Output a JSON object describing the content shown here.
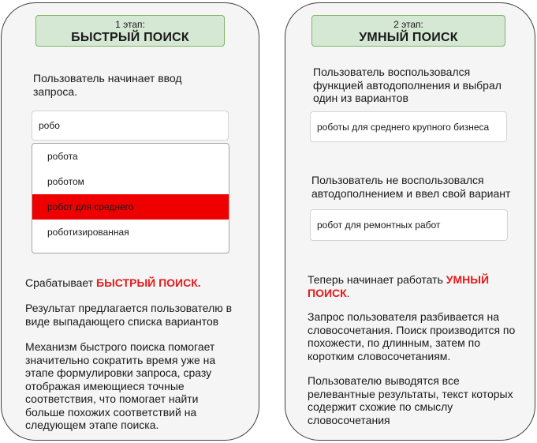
{
  "stage1": {
    "stage_label": "1 этап:",
    "title": "БЫСТРЫЙ ПОИСК",
    "intro": "Пользователь начинает ввод запроса.",
    "query_value": "робо",
    "suggestions": [
      "робота",
      "роботом",
      "робот для среднего",
      "роботизированная"
    ],
    "selected_index": 2,
    "triggers_prefix": "Срабатывает ",
    "triggers_highlight": "БЫСТРЫЙ ПОИСК.",
    "result_text": "Результат предлагается пользователю в виде выпадающего списка вариантов",
    "mechanism_text": "Механизм быстрого поиска помогает значительно сократить время уже на этапе формулировки запроса, сразу отображая имеющиеся точные соответствия, что помогает найти больше похожих соответствий на следующем этапе поиска."
  },
  "stage2": {
    "stage_label": "2 этап:",
    "title": "УМНЫЙ ПОИСК",
    "autocomplete_text": "Пользователь воспользовался функцией автодополнения и выбрал один из вариантов",
    "autocomplete_value": "роботы для среднего крупного бизнеса",
    "manual_text": "Пользователь не воспользовался автодополнением и ввел свой вариант",
    "manual_value": "робот для ремонтных работ",
    "now_prefix": "Теперь начинает работать ",
    "now_highlight": "УМНЫЙ ПОИСК",
    "now_suffix": ".",
    "split_text": "Запрос пользователя разбивается на словосочетания. Поиск производится по похожести, по длинным, затем по коротким словосочетаниям.",
    "results_text": "Пользователю выводятся все релевантные результаты, текст которых содержит схожие по смыслу словосочетания"
  },
  "colors": {
    "badge_fill": "#d5e8d4",
    "badge_border": "#82b366",
    "highlight_red": "#e31a1a",
    "selected_row": "#ee0000"
  }
}
